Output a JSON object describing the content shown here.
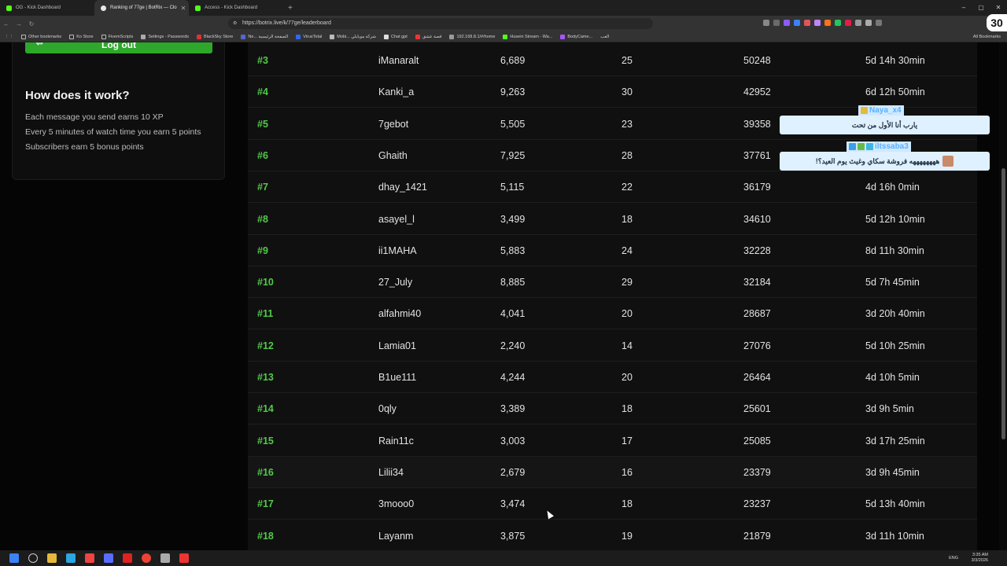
{
  "browser": {
    "tabs": [
      {
        "title": "OG - Kick Dashboard",
        "active": false
      },
      {
        "title": "Ranking of 77ge | BotRix — Clo",
        "active": true
      },
      {
        "title": "Access - Kick Dashboard",
        "active": false
      }
    ],
    "url": "https://botrix.live/k/77ge/leaderboard",
    "bookmarks": [
      "Other bookmarks",
      "Ko Store",
      "FivemScripts",
      "Settings - Passwords",
      "BlackSky Store",
      "Ne... الصفحة الرئيسية",
      "VirusTotal",
      "Mobi... شركة موبايلي",
      "Chat gpt",
      "قصة عشق",
      "192.168.8.1/#/home",
      "Husein Stream - Wa...",
      "BodyCame...",
      "العب"
    ],
    "all_bookmarks_label": "All Bookmarks"
  },
  "sidebar": {
    "logout_label": "Log out",
    "how_title": "How does it work?",
    "how_lines": [
      "Each message you send earns 10 XP",
      "Every 5 minutes of watch time you earn 5 points",
      "Subscribers earn 5 bonus points"
    ]
  },
  "leaderboard": {
    "rows": [
      {
        "rank": "#3",
        "user": "iManaralt",
        "xp": "6,689",
        "level": "25",
        "points": "50248",
        "watch": "5d 14h 30min"
      },
      {
        "rank": "#4",
        "user": "Kanki_a",
        "xp": "9,263",
        "level": "30",
        "points": "42952",
        "watch": "6d 12h 50min"
      },
      {
        "rank": "#5",
        "user": "7gebot",
        "xp": "5,505",
        "level": "23",
        "points": "39358",
        "watch": ""
      },
      {
        "rank": "#6",
        "user": "Ghaith",
        "xp": "7,925",
        "level": "28",
        "points": "37761",
        "watch": ""
      },
      {
        "rank": "#7",
        "user": "dhay_1421",
        "xp": "5,115",
        "level": "22",
        "points": "36179",
        "watch": "4d 16h 0min"
      },
      {
        "rank": "#8",
        "user": "asayel_l",
        "xp": "3,499",
        "level": "18",
        "points": "34610",
        "watch": "5d 12h 10min"
      },
      {
        "rank": "#9",
        "user": "ii1MAHA",
        "xp": "5,883",
        "level": "24",
        "points": "32228",
        "watch": "8d 11h 30min"
      },
      {
        "rank": "#10",
        "user": "27_July",
        "xp": "8,885",
        "level": "29",
        "points": "32184",
        "watch": "5d 7h 45min"
      },
      {
        "rank": "#11",
        "user": "alfahmi40",
        "xp": "4,041",
        "level": "20",
        "points": "28687",
        "watch": "3d 20h 40min"
      },
      {
        "rank": "#12",
        "user": "Lamia01",
        "xp": "2,240",
        "level": "14",
        "points": "27076",
        "watch": "5d 10h 25min"
      },
      {
        "rank": "#13",
        "user": "B1ue111",
        "xp": "4,244",
        "level": "20",
        "points": "26464",
        "watch": "4d 10h 5min"
      },
      {
        "rank": "#14",
        "user": "0qly",
        "xp": "3,389",
        "level": "18",
        "points": "25601",
        "watch": "3d 9h 5min"
      },
      {
        "rank": "#15",
        "user": "Rain11c",
        "xp": "3,003",
        "level": "17",
        "points": "25085",
        "watch": "3d 17h 25min"
      },
      {
        "rank": "#16",
        "user": "Lilii34",
        "xp": "2,679",
        "level": "16",
        "points": "23379",
        "watch": "3d 9h 45min"
      },
      {
        "rank": "#17",
        "user": "3mooo0",
        "xp": "3,474",
        "level": "18",
        "points": "23237",
        "watch": "5d 13h 40min"
      },
      {
        "rank": "#18",
        "user": "Layanm",
        "xp": "3,875",
        "level": "19",
        "points": "21879",
        "watch": "3d 11h 10min"
      }
    ]
  },
  "chat_overlay": {
    "messages": [
      {
        "user": "Naya_x4",
        "text": "يارب أنا الأول من تحت"
      },
      {
        "user": "iltssaba3",
        "text": "ههههههههه فروشة سكاي وغيث يوم العيد؟!"
      }
    ],
    "corner_logo": "30"
  },
  "taskbar": {
    "lang": "ENG",
    "time": "3:35 AM",
    "date": "3/3/2026"
  },
  "colors": {
    "accent_green": "#53c94a",
    "logout_green": "#2da82a",
    "chat_name_blue": "#5ab0ff"
  }
}
